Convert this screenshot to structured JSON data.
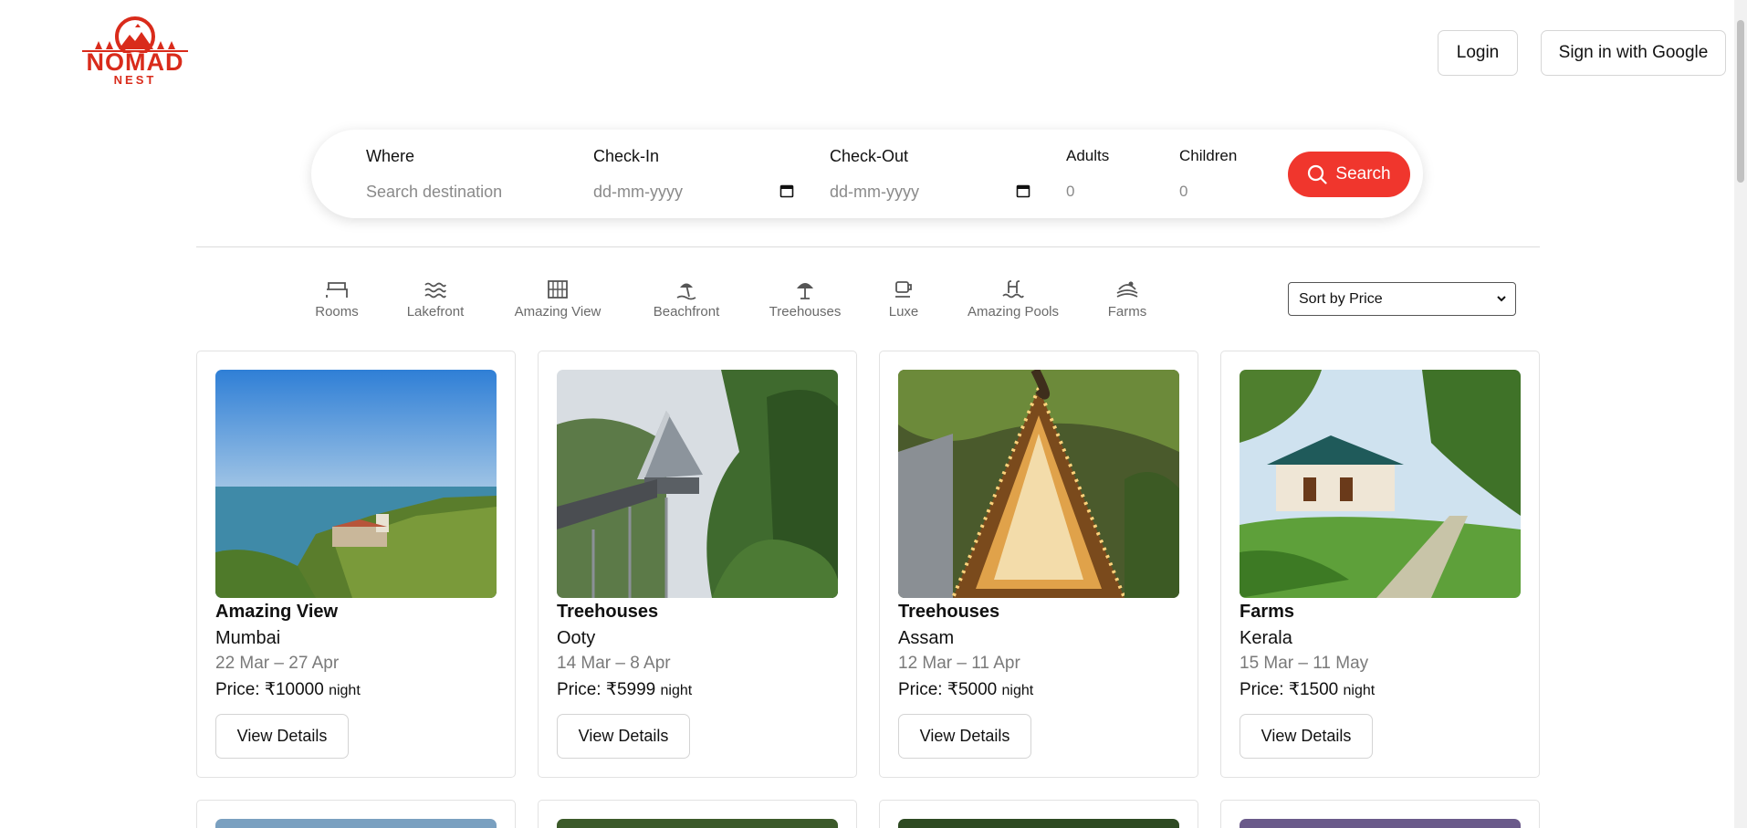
{
  "header": {
    "logo": {
      "wordmark": "NOMAD",
      "sub": "NEST",
      "color": "#d92b1b"
    },
    "login_label": "Login",
    "google_label": "Sign in with Google"
  },
  "search": {
    "where": {
      "label": "Where",
      "placeholder": "Search destination"
    },
    "checkin": {
      "label": "Check-In",
      "placeholder": "dd-mm-yyyy"
    },
    "checkout": {
      "label": "Check-Out",
      "placeholder": "dd-mm-yyyy"
    },
    "adults": {
      "label": "Adults",
      "value": "0"
    },
    "children": {
      "label": "Children",
      "value": "0"
    },
    "button_label": "Search",
    "button_color": "#f0362d"
  },
  "filters": [
    {
      "label": "Rooms",
      "icon": "bed-icon"
    },
    {
      "label": "Lakefront",
      "icon": "waves-icon"
    },
    {
      "label": "Amazing View",
      "icon": "window-view-icon"
    },
    {
      "label": "Beachfront",
      "icon": "beach-umbrella-icon"
    },
    {
      "label": "Treehouses",
      "icon": "tree-icon"
    },
    {
      "label": "Luxe",
      "icon": "luxe-cup-icon"
    },
    {
      "label": "Amazing Pools",
      "icon": "pool-icon"
    },
    {
      "label": "Farms",
      "icon": "farm-icon"
    }
  ],
  "sort": {
    "selected": "Sort by Price"
  },
  "listings": [
    {
      "category": "Amazing View",
      "location": "Mumbai",
      "dates": "22 Mar – 27 Apr",
      "price_prefix": "Price: ",
      "price": "₹10000",
      "unit": "night",
      "button": "View Details",
      "image": "coastal-fort-photo"
    },
    {
      "category": "Treehouses",
      "location": "Ooty",
      "dates": "14 Mar – 8 Apr",
      "price_prefix": "Price: ",
      "price": "₹5999",
      "unit": "night",
      "button": "View Details",
      "image": "a-frame-treehouse-photo"
    },
    {
      "category": "Treehouses",
      "location": "Assam",
      "dates": "12 Mar – 11 Apr",
      "price_prefix": "Price: ",
      "price": "₹5000",
      "unit": "night",
      "button": "View Details",
      "image": "lit-a-frame-cabin-photo"
    },
    {
      "category": "Farms",
      "location": "Kerala",
      "dates": "15 Mar – 11 May",
      "price_prefix": "Price: ",
      "price": "₹1500",
      "unit": "night",
      "button": "View Details",
      "image": "kerala-farmhouse-photo"
    }
  ]
}
